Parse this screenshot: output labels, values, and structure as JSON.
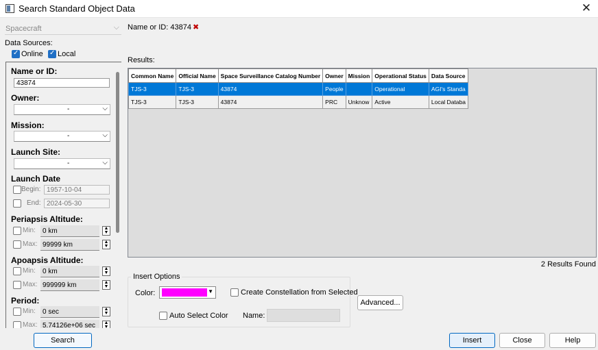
{
  "window": {
    "title": "Search Standard Object Data"
  },
  "left": {
    "object_type": "Spacecraft",
    "data_sources_label": "Data Sources:",
    "sources": {
      "online": "Online",
      "local": "Local"
    },
    "fields": {
      "name_label": "Name or ID:",
      "name_value": "43874",
      "owner_label": "Owner:",
      "owner_value": "-",
      "mission_label": "Mission:",
      "mission_value": "-",
      "launch_site_label": "Launch Site:",
      "launch_site_value": "-",
      "launch_date_label": "Launch Date",
      "begin_label": "Begin:",
      "begin_value": "1957-10-04",
      "end_label": "End:",
      "end_value": "2024-05-30",
      "periapsis_label": "Periapsis Altitude:",
      "peri_min_label": "Min:",
      "peri_min_value": "0 km",
      "peri_max_label": "Max:",
      "peri_max_value": "99999 km",
      "apoapsis_label": "Apoapsis Altitude:",
      "apo_min_label": "Min:",
      "apo_min_value": "0 km",
      "apo_max_label": "Max:",
      "apo_max_value": "999999 km",
      "period_label": "Period:",
      "per_min_label": "Min:",
      "per_min_value": "0 sec",
      "per_max_label": "Max:",
      "per_max_value": "5.74126e+06 sec"
    },
    "search_button": "Search"
  },
  "filter_chip": {
    "label": "Name or ID: 43874",
    "remove_glyph": "✖"
  },
  "results": {
    "label": "Results:",
    "columns": [
      "Common Name",
      "Official Name",
      "Space Surveillance Catalog Number",
      "Owner",
      "Mission",
      "Operational Status",
      "Data Source"
    ],
    "rows": [
      [
        "TJS-3",
        "TJS-3",
        "43874",
        "People",
        "",
        "Operational",
        "AGI's Standa"
      ],
      [
        "TJS-3",
        "TJS-3",
        "43874",
        "PRC",
        "Unknow",
        "Active",
        "Local Databa"
      ]
    ],
    "count_text": "2 Results Found"
  },
  "insert_options": {
    "title": "Insert Options",
    "color_label": "Color:",
    "color_value": "#ff00ff",
    "constellation_label": "Create Constellation from Selected",
    "auto_color_label": "Auto Select Color",
    "name_label": "Name:",
    "advanced_button": "Advanced..."
  },
  "footer": {
    "insert": "Insert",
    "close": "Close",
    "help": "Help"
  }
}
